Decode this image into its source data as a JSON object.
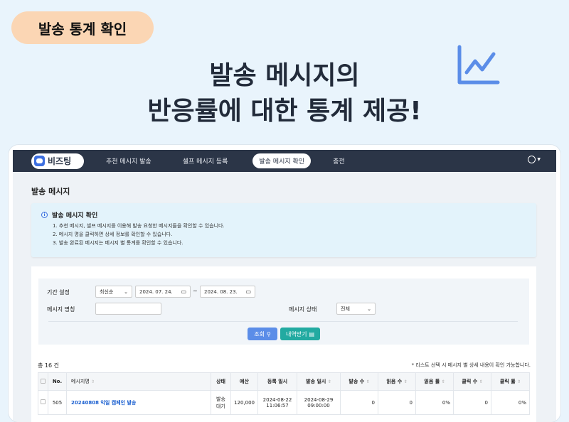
{
  "badge": "발송 통계 확인",
  "headline": {
    "line1": "발송 메시지의",
    "line2": "반응률에 대한 통계 제공!"
  },
  "nav": {
    "logo": "비즈팅",
    "items": [
      "추천 메시지 발송",
      "셀프 메시지 등록",
      "발송 메시지 확인",
      "충전"
    ],
    "active_index": 2
  },
  "page_title": "발송 메시지",
  "info": {
    "title": "발송 메시지 확인",
    "lines": [
      "1. 추천 메시지, 셀프 메시지를 이용해 발송 요청한 메시지들을 확인할 수 있습니다.",
      "2. 메시지 명을 클릭하면 상세 정보를 확인할 수 있습니다.",
      "3. 발송 완료된 메시지는 메시지 별 통계를 확인할 수 있습니다."
    ]
  },
  "filter": {
    "period_label": "기간 설정",
    "order_value": "최신순",
    "date_from": "2024. 07. 24.",
    "date_to": "2024. 08. 23.",
    "tilde": "~",
    "name_label": "메시지 명칭",
    "name_value": "",
    "status_label": "메시지 상태",
    "status_value": "전체",
    "search_button": "조회",
    "export_button": "내역받기"
  },
  "total": "총 16 건",
  "note": "* 리스트 선택 시 메시지 별 상세 내용이 확인 가능합니다.",
  "table": {
    "headers": [
      "No.",
      "메시지명",
      "상태",
      "예산",
      "등록 일시",
      "발송 일시",
      "발송 수",
      "읽음 수",
      "읽음 률",
      "클릭 수",
      "클릭 률"
    ],
    "row": {
      "no": "505",
      "name": "20240808 익일 캠페인 발송",
      "status1": "발송",
      "status2": "대기",
      "budget": "120,000",
      "reg_date": "2024-08-22",
      "reg_time": "11:06:57",
      "send_date": "2024-08-29",
      "send_time": "09:00:00",
      "send_count": "0",
      "read_count": "0",
      "read_rate": "0%",
      "click_count": "0",
      "click_rate": "0%"
    }
  },
  "colors": {
    "accent": "#3d6fe0",
    "nav_bg": "#2b3547",
    "badge_bg": "#fbd6b4",
    "search_btn": "#5b8de8",
    "export_btn": "#22aaa1"
  }
}
